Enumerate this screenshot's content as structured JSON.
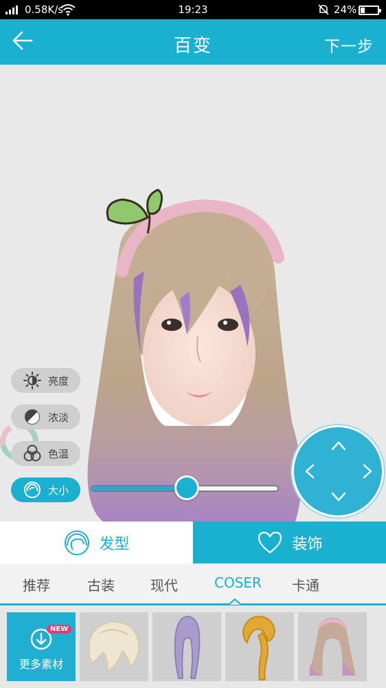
{
  "status_bar": {
    "speed": "0.58K/s",
    "time": "19:23",
    "battery_text": "24%",
    "battery_level": 0.24
  },
  "header": {
    "back_icon": "back-arrow-icon",
    "title": "百变",
    "next_label": "下一步"
  },
  "adjust_tools": [
    {
      "label": "亮度",
      "icon": "brightness-icon",
      "active": false
    },
    {
      "label": "浓淡",
      "icon": "contrast-icon",
      "active": false
    },
    {
      "label": "色温",
      "icon": "color-temperature-icon",
      "active": false
    },
    {
      "label": "大小",
      "icon": "size-icon",
      "active": true
    }
  ],
  "size_slider": {
    "value": 0.51
  },
  "dpad": {
    "up": "chevron-up-icon",
    "down": "chevron-down-icon",
    "left": "chevron-left-icon",
    "right": "chevron-right-icon"
  },
  "category_tabs": [
    {
      "label": "发型",
      "icon": "hair-icon",
      "selected": true
    },
    {
      "label": "装饰",
      "icon": "heart-icon",
      "selected": false
    }
  ],
  "sub_tabs": [
    {
      "label": "推荐",
      "selected": false
    },
    {
      "label": "古装",
      "selected": false
    },
    {
      "label": "现代",
      "selected": false
    },
    {
      "label": "COSER",
      "selected": true
    },
    {
      "label": "卡通",
      "selected": false
    }
  ],
  "items": {
    "more": {
      "label": "更多素材",
      "badge": "NEW",
      "icon": "download-icon"
    },
    "hairstyles": [
      "platinum-short-wig",
      "purple-long-wig",
      "blonde-ponytail-wig",
      "pink-headband-long-wig"
    ]
  },
  "colors": {
    "accent": "#1ab0cf",
    "badge": "#ea3b6e"
  }
}
